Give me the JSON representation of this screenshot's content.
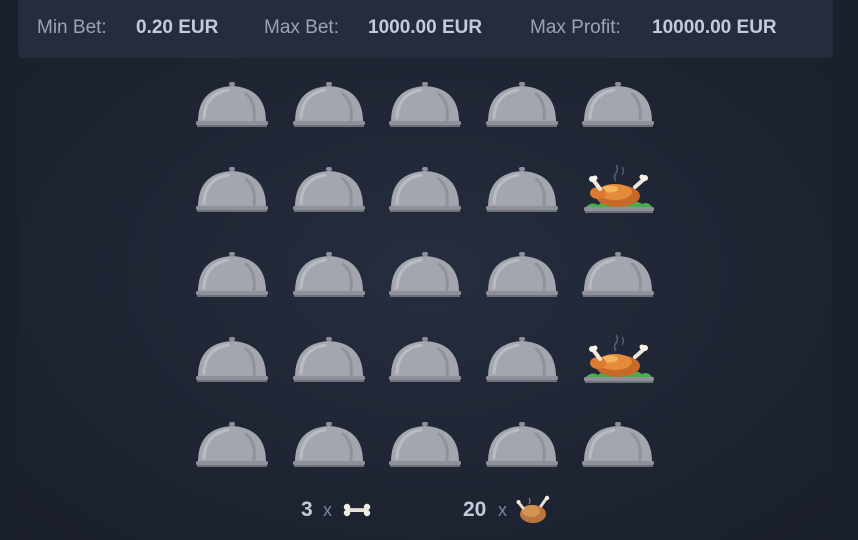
{
  "limits": {
    "min_bet_label": "Min Bet:",
    "min_bet_value": "0.20 EUR",
    "max_bet_label": "Max Bet:",
    "max_bet_value": "1000.00 EUR",
    "max_profit_label": "Max Profit:",
    "max_profit_value": "10000.00 EUR"
  },
  "grid": {
    "rows": 5,
    "cols": 5,
    "cells": [
      [
        "cloche",
        "cloche",
        "cloche",
        "cloche",
        "cloche"
      ],
      [
        "cloche",
        "cloche",
        "cloche",
        "cloche",
        "chicken"
      ],
      [
        "cloche",
        "cloche",
        "cloche",
        "cloche",
        "cloche"
      ],
      [
        "cloche",
        "cloche",
        "cloche",
        "cloche",
        "chicken"
      ],
      [
        "cloche",
        "cloche",
        "cloche",
        "cloche",
        "cloche"
      ]
    ]
  },
  "summary": {
    "bone_count": "3",
    "bone_times": "x",
    "bone_icon": "bone-icon",
    "chicken_count": "20",
    "chicken_times": "x",
    "chicken_icon": "roast-chicken-icon"
  },
  "colors": {
    "background": "#1b202d",
    "panel": "#262c3b",
    "cloche": "#9fa1a9",
    "label": "#9aa3b8",
    "value": "#c4cad9"
  }
}
